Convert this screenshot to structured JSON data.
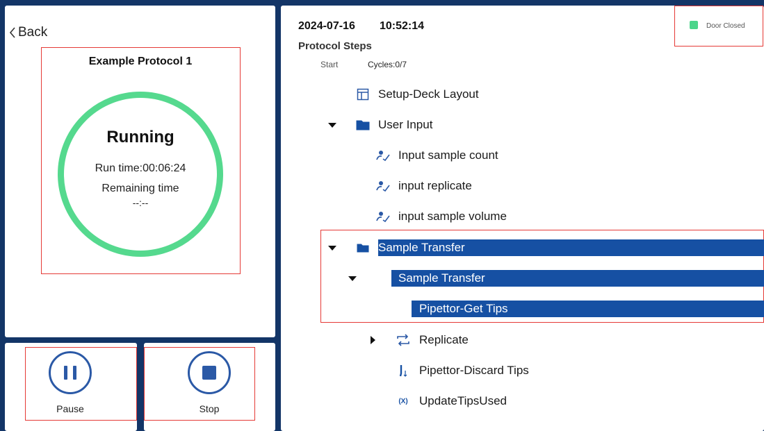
{
  "back": {
    "label": "Back"
  },
  "run": {
    "protocol_name": "Example Protocol 1",
    "status": "Running",
    "run_time": "Run time:00:06:24",
    "remaining_label": "Remaining time",
    "remaining_value": "--:--"
  },
  "controls": {
    "pause_label": "Pause",
    "stop_label": "Stop"
  },
  "header": {
    "date": "2024-07-16",
    "time": "10:52:14",
    "door_status": "Door Closed",
    "door_color": "#4cd58b"
  },
  "steps_panel": {
    "title": "Protocol Steps",
    "start_label": "Start",
    "cycles": "Cycles:0/7"
  },
  "steps": [
    {
      "label": "Setup-Deck Layout",
      "icon": "layout-icon",
      "expander": "none",
      "selected": false
    },
    {
      "label": "User Input",
      "icon": "folder-icon",
      "expander": "expanded",
      "selected": false
    },
    {
      "label": "Input sample count",
      "icon": "user-input-icon",
      "expander": "none",
      "selected": false
    },
    {
      "label": "input replicate",
      "icon": "user-input-icon",
      "expander": "none",
      "selected": false
    },
    {
      "label": "input sample volume",
      "icon": "user-input-icon",
      "expander": "none",
      "selected": false
    },
    {
      "label": "Sample Transfer",
      "icon": "folder-icon",
      "expander": "expanded",
      "selected": true
    },
    {
      "label": "Sample Transfer",
      "icon": "loop-icon",
      "expander": "expanded",
      "selected": true
    },
    {
      "label": "Pipettor-Get Tips",
      "icon": "pipette-up-icon",
      "expander": "none",
      "selected": true
    },
    {
      "label": "Replicate",
      "icon": "loop-icon",
      "expander": "collapsed",
      "selected": false
    },
    {
      "label": "Pipettor-Discard Tips",
      "icon": "pipette-down-icon",
      "expander": "none",
      "selected": false
    },
    {
      "label": "UpdateTipsUsed",
      "icon": "variable-icon",
      "expander": "none",
      "selected": false
    }
  ],
  "variable_icon_glyph": "(X)",
  "colors": {
    "background": "#133567",
    "accent": "#1650a3",
    "ring": "#55d98e",
    "highlight_outline": "#e53935"
  }
}
